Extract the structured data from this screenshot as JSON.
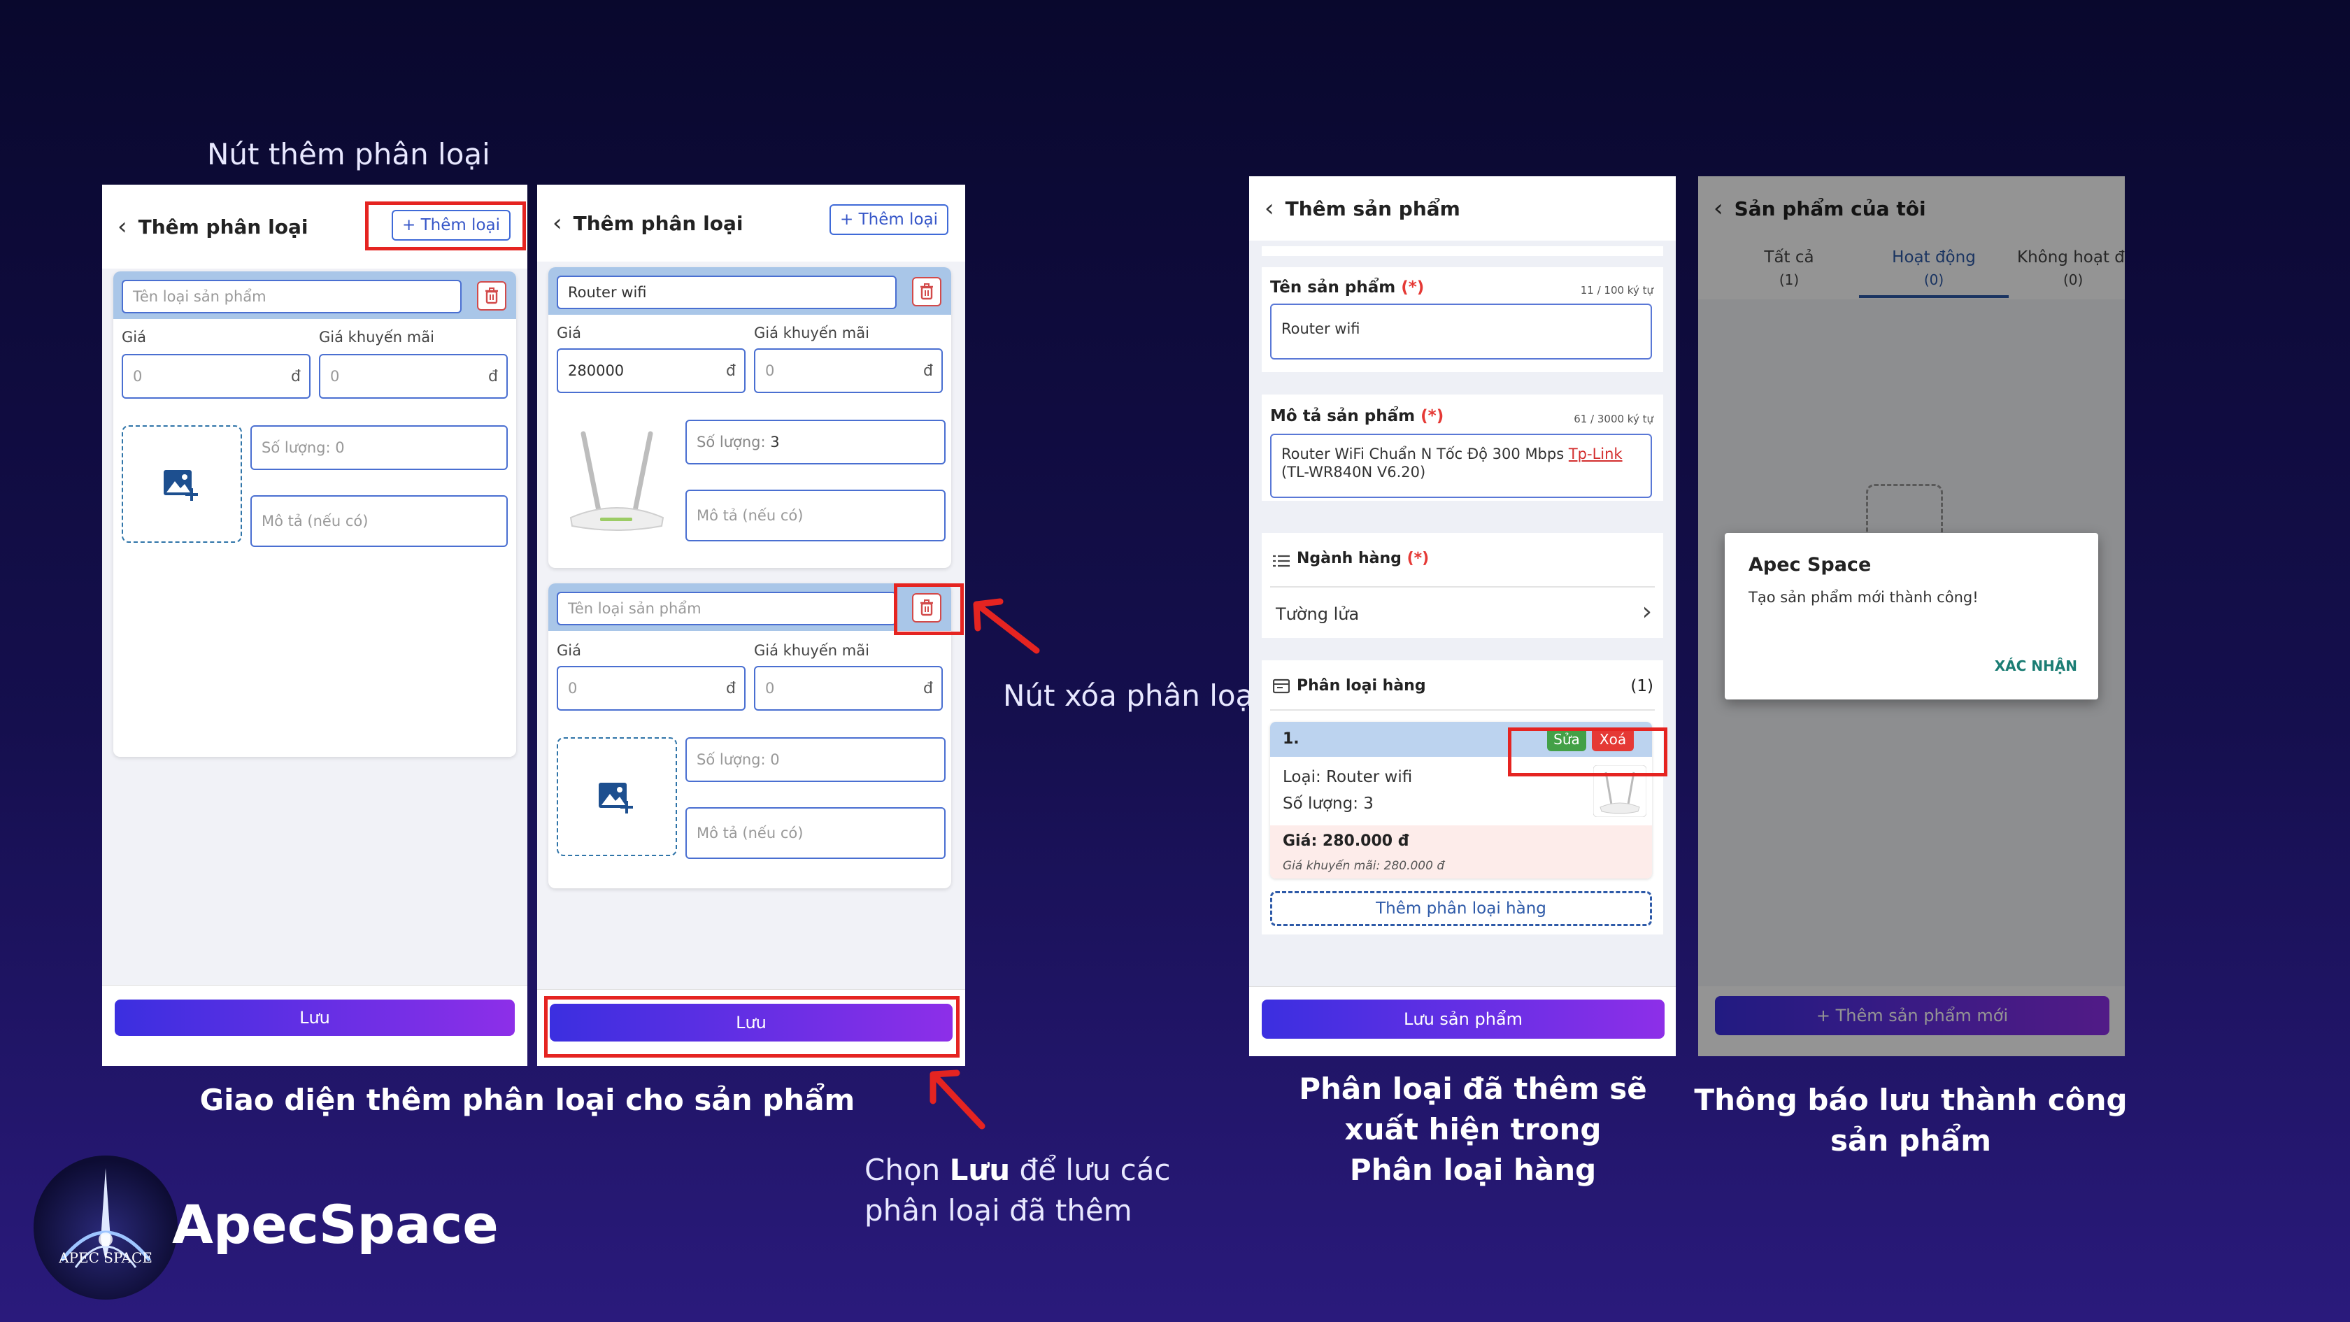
{
  "annotations": {
    "add_variant_note": "Nút thêm phân loại",
    "delete_variant_note": "Nút xóa phân loại",
    "save_note_prefix": "Chọn ",
    "save_note_bold": "Lưu",
    "save_note_suffix": " để lưu các",
    "save_note_line2": "phân loại đã thêm"
  },
  "captions": {
    "caption1": "Giao diện thêm phân loại cho sản phẩm",
    "caption3_line1": "Phân loại đã thêm sẽ",
    "caption3_line2": "xuất hiện trong",
    "caption3_line3": "Phân loại hàng",
    "caption4_line1": "Thông báo lưu thành công",
    "caption4_line2": "sản phẩm"
  },
  "brand": {
    "name": "ApecSpace",
    "logo_text": "APEC SPACE"
  },
  "screen1": {
    "title": "Thêm phân loại",
    "add_label": "+ Thêm loại",
    "name_placeholder": "Tên loại sản phẩm",
    "price_label": "Giá",
    "promo_label": "Giá khuyến mãi",
    "price_value": "0",
    "promo_value": "0",
    "currency": "đ",
    "qty_value": "Số lượng: 0",
    "desc_placeholder": "Mô tả (nếu có)",
    "save_label": "Lưu"
  },
  "screen2": {
    "title": "Thêm phân loại",
    "add_label": "+ Thêm loại",
    "card1": {
      "name": "Router wifi",
      "price_label": "Giá",
      "promo_label": "Giá khuyến mãi",
      "price": "280000",
      "promo": "0",
      "currency": "đ",
      "qty_label": "Số lượng:",
      "qty_value": "3",
      "desc_placeholder": "Mô tả (nếu có)"
    },
    "card2": {
      "name_placeholder": "Tên loại sản phẩm",
      "price_label": "Giá",
      "promo_label": "Giá khuyến mãi",
      "price": "0",
      "promo": "0",
      "currency": "đ",
      "qty_value": "Số lượng: 0",
      "desc_placeholder": "Mô tả (nếu có)"
    },
    "save_label": "Lưu"
  },
  "screen3": {
    "title": "Thêm sản phẩm",
    "name_label": "Tên sản phẩm",
    "required_mark": "(*)",
    "name_counter": "11 / 100 ký tự",
    "name_value": "Router wifi",
    "desc_label": "Mô tả sản phẩm",
    "desc_counter": "61 / 3000 ký tự",
    "desc_value_main": "Router WiFi Chuẩn N Tốc Độ 300 Mbps ",
    "desc_value_link": "Tp-Link",
    "desc_value_line2": "(TL-WR840N V6.20)",
    "category_label": "Ngành hàng",
    "category_value": "Tường lửa",
    "variants_label": "Phân loại hàng",
    "variants_count": "(1)",
    "variant": {
      "index": "1.",
      "edit": "Sửa",
      "delete": "Xoá",
      "type": "Loại: Router wifi",
      "qty": "Số lượng: 3",
      "price": "Giá: 280.000 đ",
      "promo": "Giá khuyến mãi: 280.000 đ"
    },
    "add_variant_label": "Thêm phân loại hàng",
    "save_label": "Lưu sản phẩm"
  },
  "screen4": {
    "title": "Sản phẩm của tôi",
    "tabs": [
      {
        "label": "Tất cả",
        "count": "(1)"
      },
      {
        "label": "Hoạt động",
        "count": "(0)"
      },
      {
        "label": "Không hoạt đ",
        "count": "(0)"
      }
    ],
    "dialog": {
      "title": "Apec Space",
      "message": "Tạo sản phẩm mới thành công!",
      "confirm": "XÁC NHẬN"
    },
    "add_product_label": "+ Thêm sản phẩm mới"
  },
  "colors": {
    "accent": "#3b2fe0",
    "danger": "#e52421",
    "success": "#43a047",
    "link_red": "#e53935"
  }
}
